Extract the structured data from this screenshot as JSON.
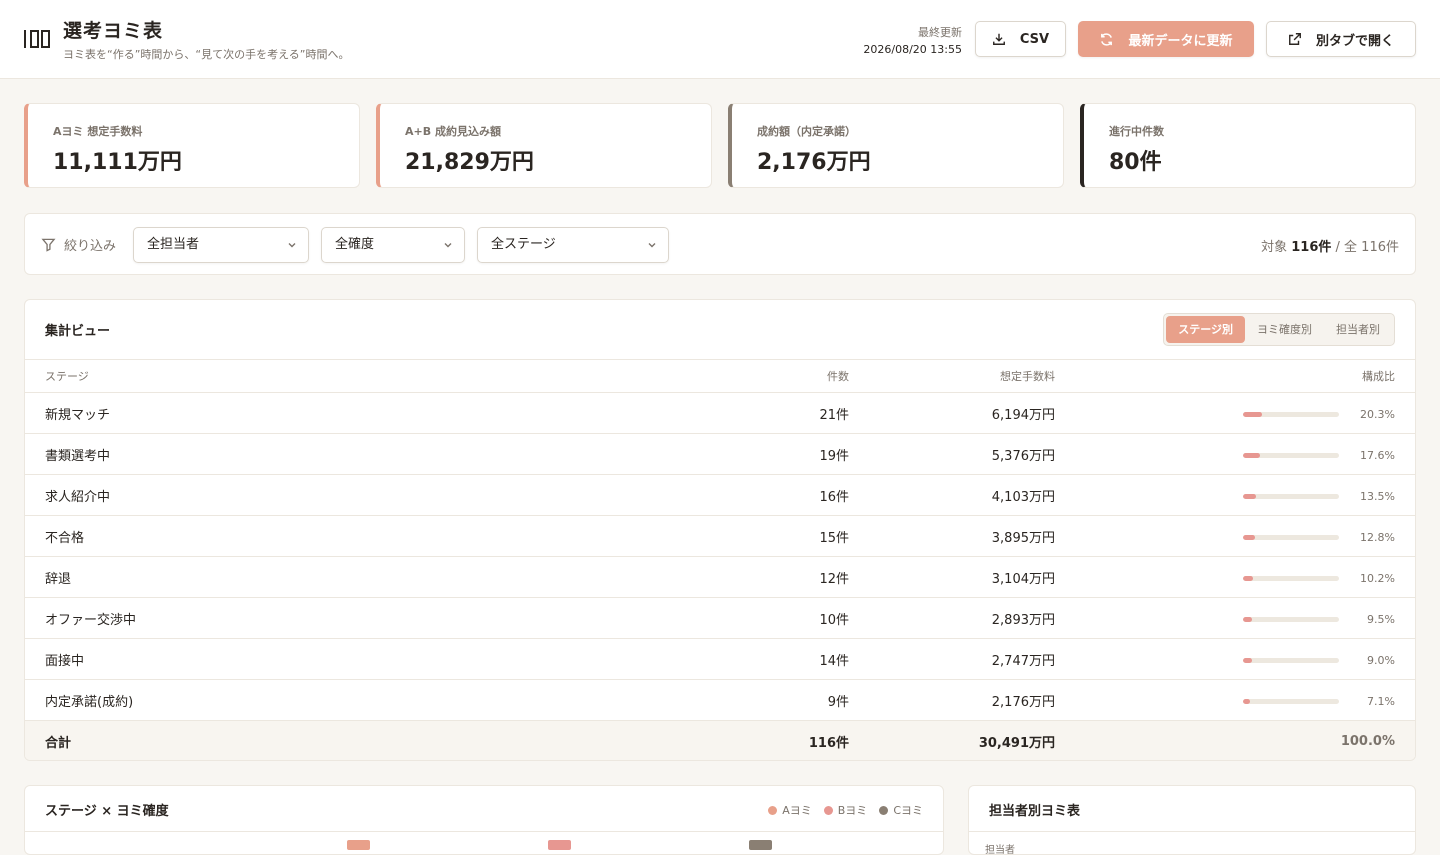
{
  "app": {
    "title": "選考ヨミ表",
    "subtitle": "ヨミ表を“作る”時間から、“見て次の手を考える”時間へ。",
    "updated_label": "最終更新",
    "updated_value": "2026/08/20 13:55",
    "csv_label": "CSV",
    "refresh_label": "最新データに更新",
    "open_tab_label": "別タブで開く"
  },
  "kpis": [
    {
      "label": "Aヨミ 想定手数料",
      "value": "11,111万円",
      "accent": "#e8a08a"
    },
    {
      "label": "A+B 成約見込み額",
      "value": "21,829万円",
      "accent": "#e8a08a"
    },
    {
      "label": "成約額（内定承諾）",
      "value": "2,176万円",
      "accent": "#8a7f73"
    },
    {
      "label": "進行中件数",
      "value": "80件",
      "accent": "#2a2521"
    }
  ],
  "filters": {
    "label": "絞り込み",
    "owner": "全担当者",
    "certainty": "全確度",
    "stage": "全ステージ",
    "count_prefix": "対象",
    "count_value": "116件",
    "count_sep": "/",
    "count_total": "全 116件"
  },
  "summary": {
    "title": "集計ビュー",
    "tabs": [
      "ステージ別",
      "ヨミ確度別",
      "担当者別"
    ],
    "columns": [
      "ステージ",
      "件数",
      "想定手数料",
      "構成比"
    ],
    "rows": [
      {
        "stage": "新規マッチ",
        "count": "21件",
        "fee": "6,194万円",
        "ratio": 20.3,
        "pct": "20.3%"
      },
      {
        "stage": "書類選考中",
        "count": "19件",
        "fee": "5,376万円",
        "ratio": 17.6,
        "pct": "17.6%"
      },
      {
        "stage": "求人紹介中",
        "count": "16件",
        "fee": "4,103万円",
        "ratio": 13.5,
        "pct": "13.5%"
      },
      {
        "stage": "不合格",
        "count": "15件",
        "fee": "3,895万円",
        "ratio": 12.8,
        "pct": "12.8%"
      },
      {
        "stage": "辞退",
        "count": "12件",
        "fee": "3,104万円",
        "ratio": 10.2,
        "pct": "10.2%"
      },
      {
        "stage": "オファー交渉中",
        "count": "10件",
        "fee": "2,893万円",
        "ratio": 9.5,
        "pct": "9.5%"
      },
      {
        "stage": "面接中",
        "count": "14件",
        "fee": "2,747万円",
        "ratio": 9.0,
        "pct": "9.0%"
      },
      {
        "stage": "内定承諾(成約)",
        "count": "9件",
        "fee": "2,176万円",
        "ratio": 7.1,
        "pct": "7.1%"
      }
    ],
    "total": {
      "stage": "合計",
      "count": "116件",
      "fee": "30,491万円",
      "pct": "100.0%"
    }
  },
  "stage_matrix": {
    "title": "ステージ × ヨミ確度",
    "legend": [
      {
        "label": "Aヨミ",
        "color": "#e8a08a"
      },
      {
        "label": "Bヨミ",
        "color": "#e79791"
      },
      {
        "label": "Cヨミ",
        "color": "#8a7f73"
      }
    ]
  },
  "owner_panel": {
    "title": "担当者別ヨミ表",
    "col_owner": "担当者"
  }
}
